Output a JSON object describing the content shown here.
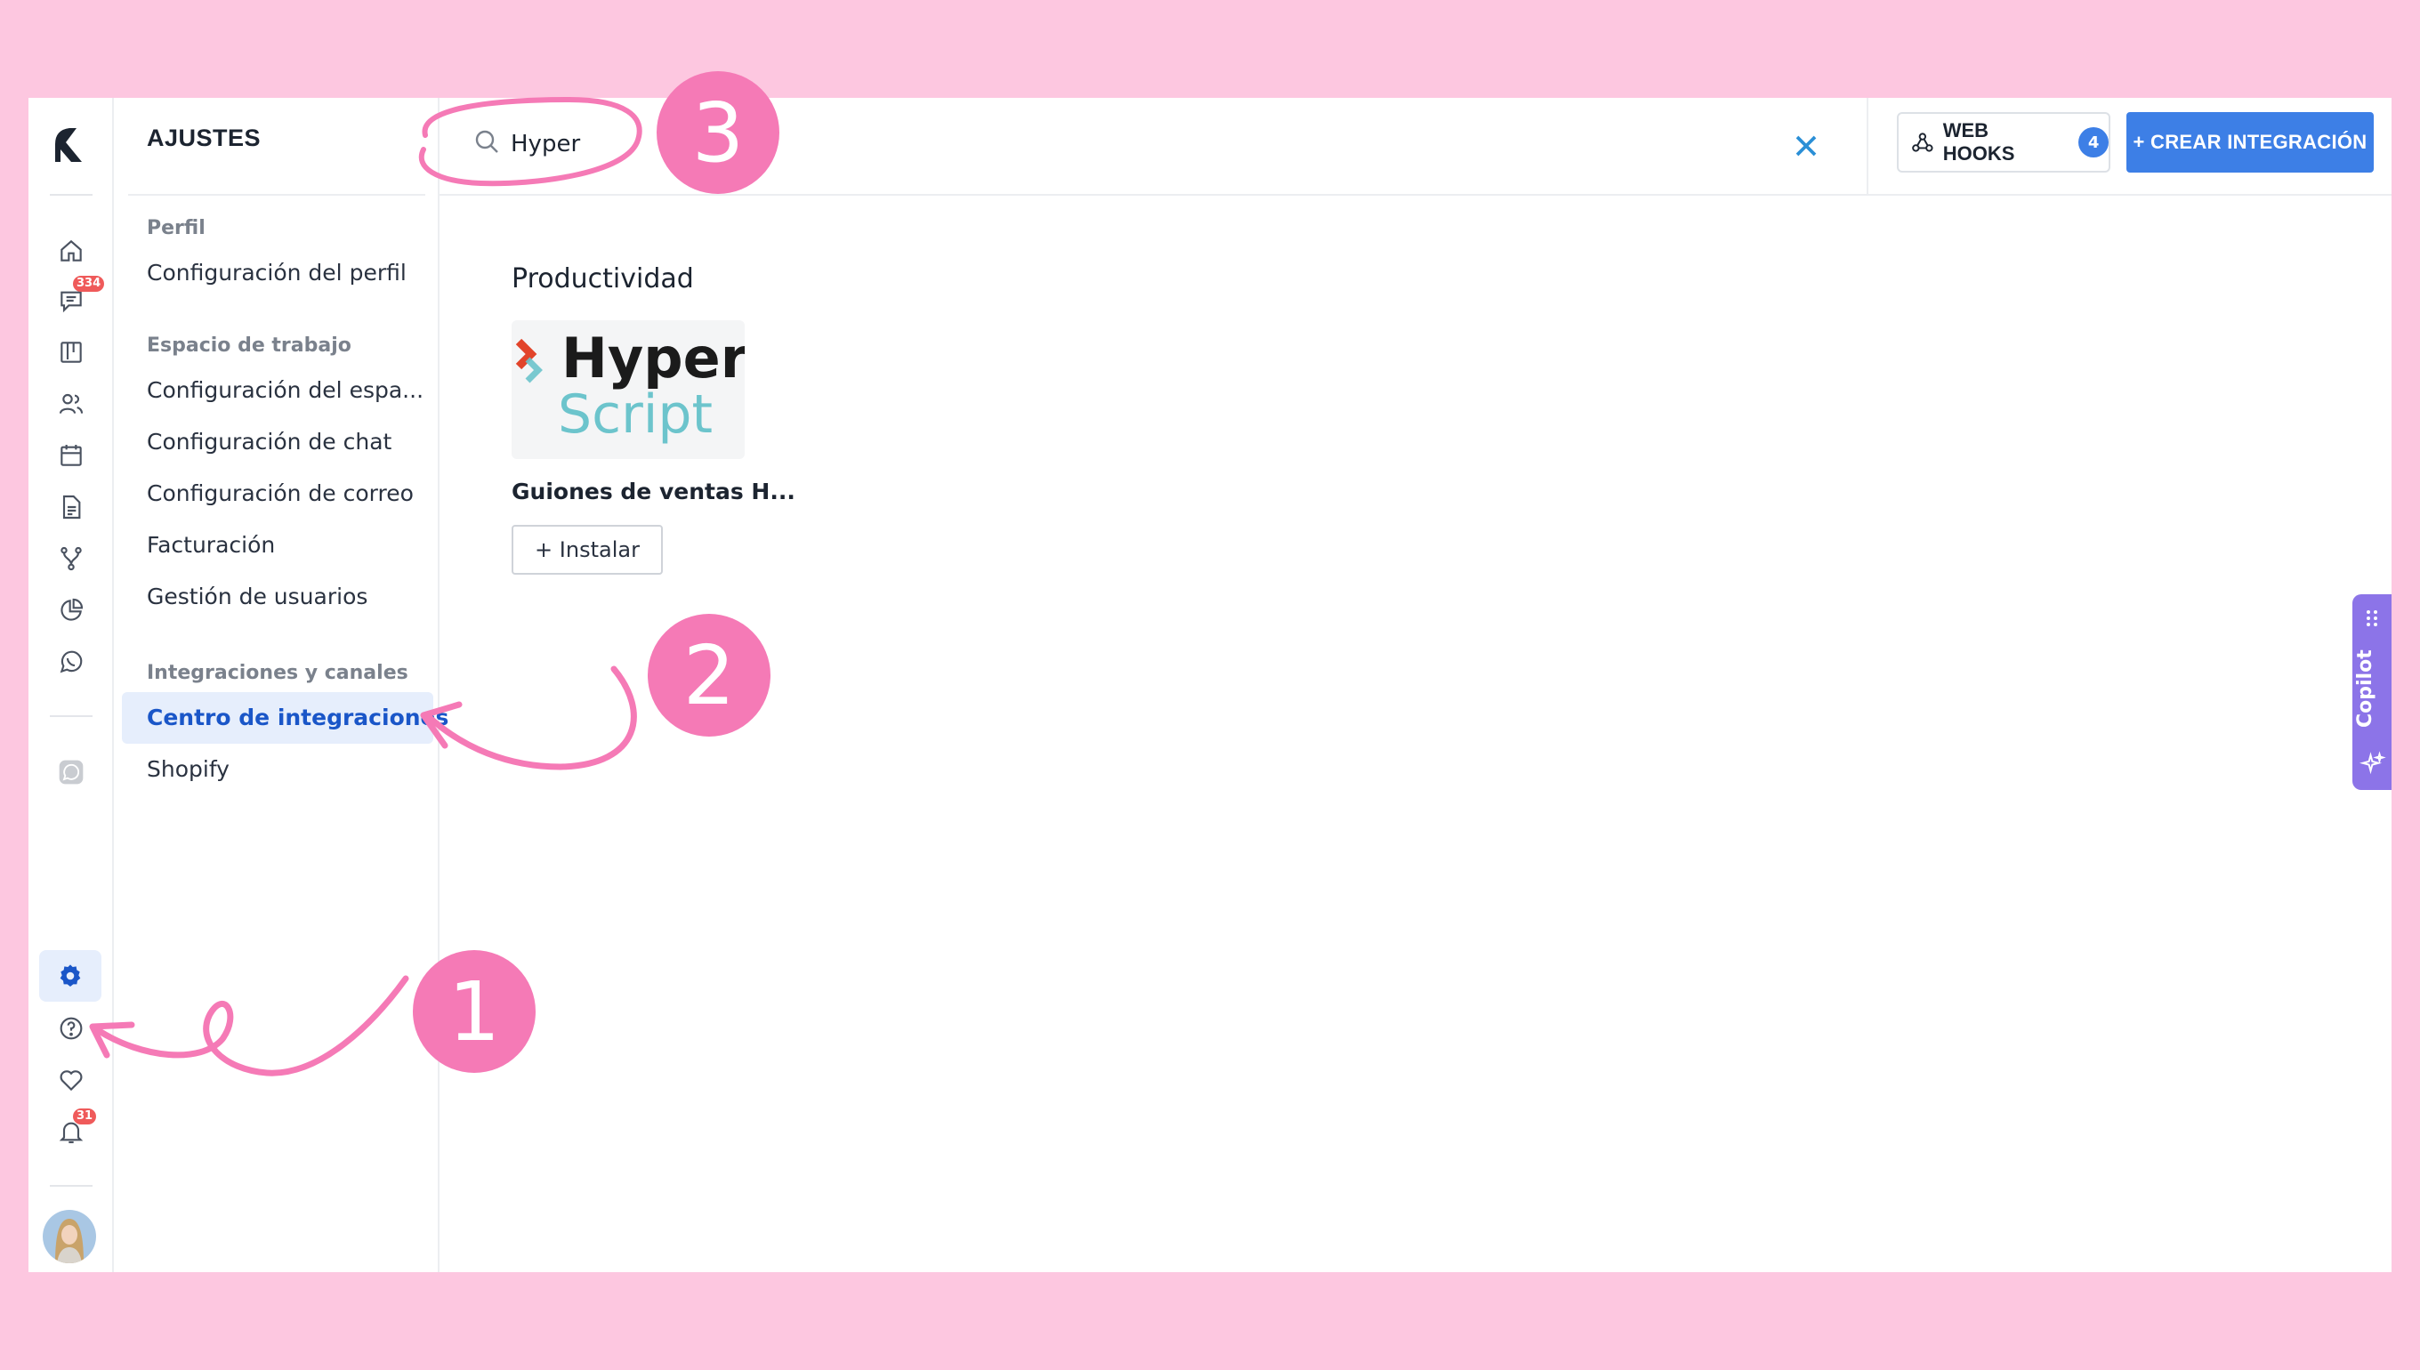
{
  "rail": {
    "badges": {
      "chat": "334",
      "notifications": "31"
    },
    "icons": [
      "home-icon",
      "chat-icon",
      "board-icon",
      "contacts-icon",
      "calendar-icon",
      "document-icon",
      "workflow-icon",
      "reports-icon",
      "whatsapp-icon",
      "whatsapp-channel-icon",
      "settings-icon",
      "help-icon",
      "heart-icon",
      "bell-icon"
    ]
  },
  "settings": {
    "title": "AJUSTES",
    "sections": [
      {
        "label": "Perfil",
        "items": [
          "Configuración del perfil"
        ]
      },
      {
        "label": "Espacio de trabajo",
        "items": [
          "Configuración del espa...",
          "Configuración de chat",
          "Configuración de correo",
          "Facturación",
          "Gestión de usuarios"
        ]
      },
      {
        "label": "Integraciones y canales",
        "items": [
          "Centro de integraciones",
          "Shopify"
        ]
      }
    ]
  },
  "topbar": {
    "search_value": "Hyper",
    "webhooks_label": "WEB HOOKS",
    "webhooks_count": "4",
    "create_label": "+ CREAR INTEGRACIÓN"
  },
  "content": {
    "category": "Productividad",
    "card": {
      "logo_line1": "Hyper",
      "logo_line2": "Script",
      "name": "Guiones de ventas H...",
      "install_label": "+ Instalar"
    }
  },
  "copilot": {
    "label": "Copilot"
  },
  "annotations": {
    "step1": "1",
    "step2": "2",
    "step3": "3"
  },
  "colors": {
    "accent": "#3d7fe6",
    "annotation": "#f57ab6",
    "background": "#fdc7e0",
    "copilot": "#8c74e8",
    "active_bg": "#e6eefc"
  }
}
